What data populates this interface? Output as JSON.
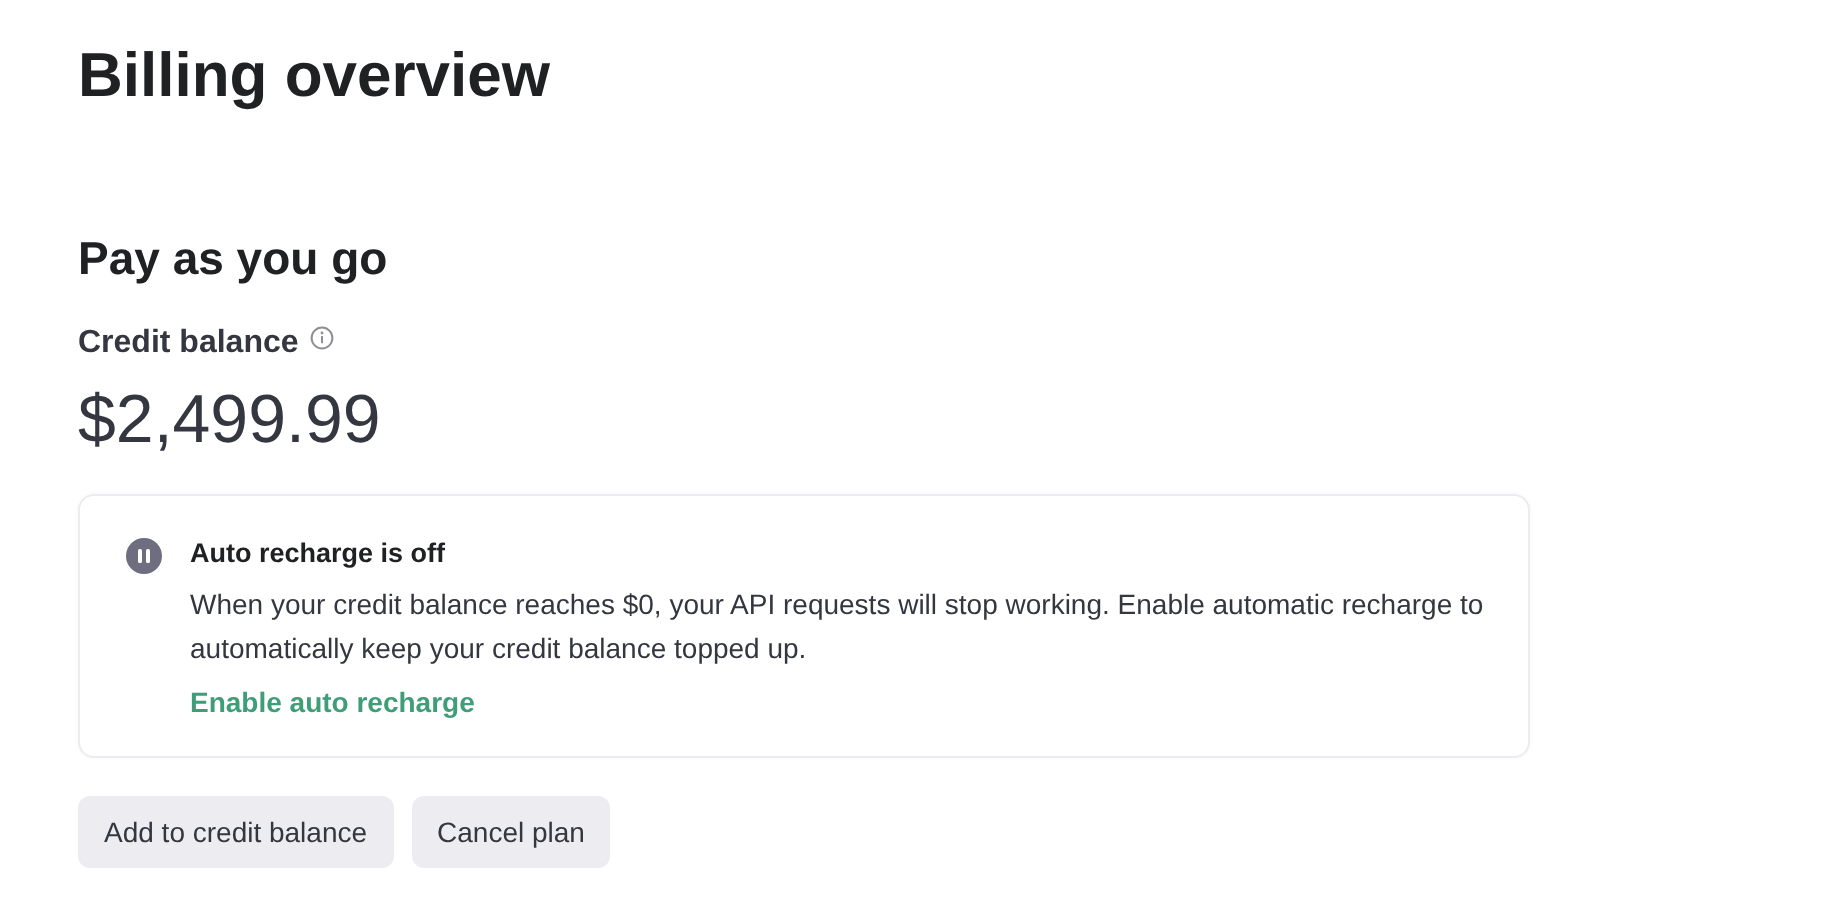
{
  "title": "Billing overview",
  "plan": {
    "name": "Pay as you go",
    "balance_label": "Credit balance",
    "balance": "$2,499.99"
  },
  "auto_recharge": {
    "on": false,
    "heading": "Auto recharge is off",
    "text": "When your credit balance reaches $0, your API requests will stop working. Enable automatic recharge to automatically keep your credit balance topped up.",
    "link": "Enable auto recharge"
  },
  "buttons": [
    "Add to credit balance",
    "Cancel plan"
  ]
}
